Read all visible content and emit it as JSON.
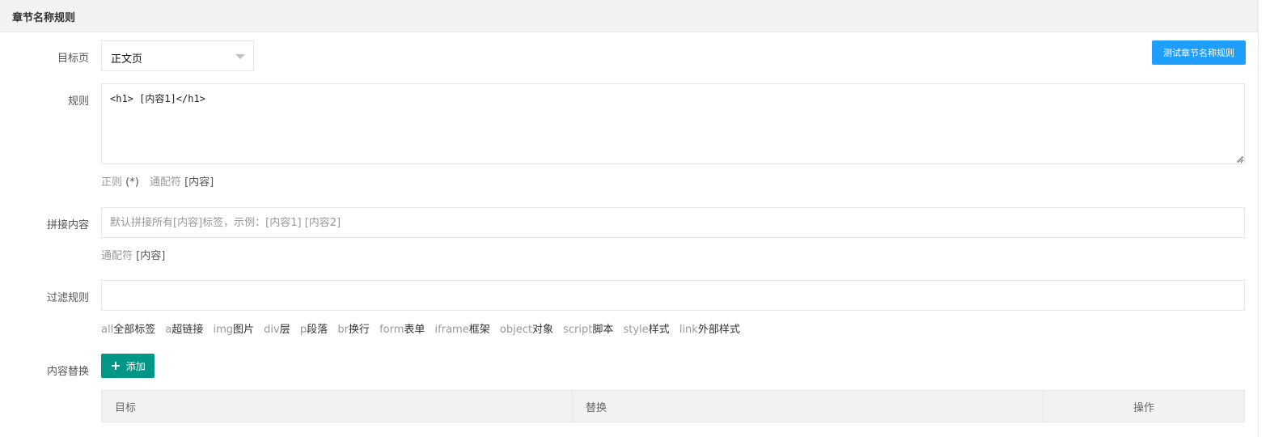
{
  "panel": {
    "title": "章节名称规则"
  },
  "target_page": {
    "label": "目标页",
    "selected": "正文页"
  },
  "test_button": {
    "label": "测试章节名称规则"
  },
  "rule": {
    "label": "规则",
    "value": "<h1> [内容1]</h1>",
    "hint": {
      "regex_text": "正则",
      "regex_key": "(*)",
      "wildcard_text": "通配符",
      "wildcard_key": "[内容]"
    }
  },
  "concat": {
    "label": "拼接内容",
    "placeholder": "默认拼接所有[内容]标签，示例：[内容1] [内容2]",
    "hint": {
      "wildcard_text": "通配符",
      "wildcard_key": "[内容]"
    }
  },
  "filter": {
    "label": "过滤规则",
    "value": "",
    "tags": [
      {
        "code": "all",
        "desc": "全部标签"
      },
      {
        "code": "a",
        "desc": "超链接"
      },
      {
        "code": "img",
        "desc": "图片"
      },
      {
        "code": "div",
        "desc": "层"
      },
      {
        "code": "p",
        "desc": "段落"
      },
      {
        "code": "br",
        "desc": "换行"
      },
      {
        "code": "form",
        "desc": "表单"
      },
      {
        "code": "iframe",
        "desc": "框架"
      },
      {
        "code": "object",
        "desc": "对象"
      },
      {
        "code": "script",
        "desc": "脚本"
      },
      {
        "code": "style",
        "desc": "样式"
      },
      {
        "code": "link",
        "desc": "外部样式"
      }
    ]
  },
  "replace": {
    "label": "内容替换",
    "add_button": "添加",
    "columns": {
      "target": "目标",
      "replace": "替换",
      "ops": "操作"
    }
  },
  "colors": {
    "primary_blue": "#1e9fff",
    "teal": "#009688",
    "header_bg": "#f2f2f2",
    "border": "#e6e6e6"
  },
  "icons": {
    "select_caret": "caret-down-icon",
    "add": "plus-icon",
    "resize": "resize-grip-icon"
  }
}
